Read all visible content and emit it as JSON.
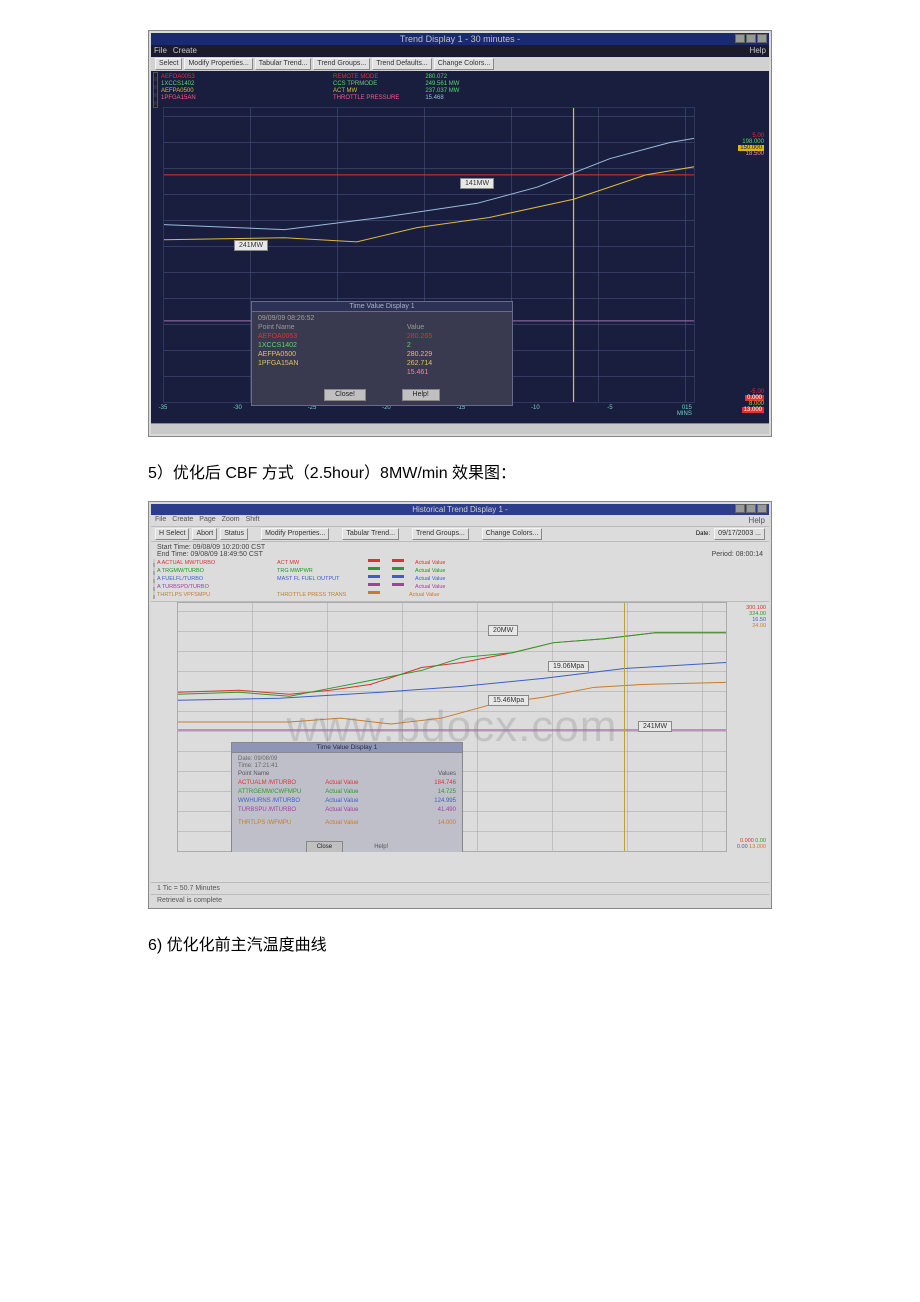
{
  "caption5": "5）优化后 CBF 方式（2.5hour）8MW/min 效果图：",
  "caption6": "6) 优化化前主汽温度曲线",
  "fig1": {
    "title": "Trend Display 1 - 30 minutes -",
    "menubar": [
      "File",
      "Create"
    ],
    "help": "Help",
    "toolbar": {
      "select": "Select",
      "modify": "Modify Properties...",
      "tabular": "Tabular Trend...",
      "groups": "Trend Groups...",
      "defaults": "Trend Defaults...",
      "colors": "Change Colors..."
    },
    "legend": {
      "col1": [
        "AEFOA0053",
        "1XCCS1402",
        "AEFPA0500",
        "1PFGA15AN"
      ],
      "col2": [
        "REMOTE MODE",
        "CCS TPRMODE",
        "ACT    MW",
        "THROTTLE PRESSURE"
      ],
      "col3": [
        "280.072",
        "249.561   MW",
        "237.037   MW",
        "15.468"
      ],
      "colors": {
        "c1": "#d33",
        "c2": "#5bd66b",
        "c3": "#dab93a",
        "c4": "#f58",
        "c5": "#9bd",
        "c6": "#dab93a"
      }
    },
    "axis_right_top": [
      "5.00",
      "198.000",
      "150.000",
      "18.500"
    ],
    "axis_right_bot": [
      "-5.00",
      "0.000",
      "8.000",
      "13.000"
    ],
    "axis_x": [
      "-35",
      "-30",
      "-25",
      "-20",
      "-15",
      "-10",
      "-5",
      "015"
    ],
    "axis_x_label": "MINS",
    "tags": {
      "t1": "241MW",
      "t2": "141MW"
    },
    "popup": {
      "title": "Time Value Display 1",
      "dt": "09/09/09  08:26:52",
      "hdr_name": "Point Name",
      "hdr_val": "Value",
      "rows": [
        {
          "name": "AEFOA0053",
          "val": "280.265",
          "cls": "c-r"
        },
        {
          "name": "1XCCS1402",
          "val": "2",
          "cls": "c-g"
        },
        {
          "name": "AEFPA0500",
          "val": "280.229",
          "cls": "c-y"
        },
        {
          "name": "1PFGA15AN",
          "val": "262.714",
          "cls": "c-y"
        },
        {
          "name": " ",
          "val": "15.461",
          "cls": "c-p"
        }
      ],
      "btn_close": "Close!",
      "btn_help": "Help!"
    }
  },
  "fig2": {
    "title": "Historical Trend Display 1 -",
    "menubar": [
      "File",
      "Create",
      "Page",
      "Zoom",
      "Shift"
    ],
    "help": "Help",
    "toolbar": {
      "select_lbl": "H Select",
      "abort": "Abort",
      "status": "Status",
      "modify": "Modify Properties...",
      "tabular": "Tabular Trend...",
      "groups": "Trend Groups...",
      "colors": "Change Colors...",
      "date_lbl": "Date:",
      "date_val": "09/17/2003 ...",
      "period_lbl": "Period:",
      "period_val": "08:00:14"
    },
    "time": {
      "start": "Start Time:  09/08/09 10:20:00 CST",
      "end": "End Time:    09/08/09 18:49:50 CST"
    },
    "legend_rows": [
      {
        "cls": "c-r",
        "name": "A ACTUAL MW/TURBO",
        "right": "ACT    MW",
        "act": "Actual Value"
      },
      {
        "cls": "c-g",
        "name": "A TRGMW/TURBO",
        "right": "TRG  MWPWR",
        "act": "Actual Value"
      },
      {
        "cls": "c-b",
        "name": "A FUELFL/TURBO",
        "right": "MAST FL FUEL OUTPUT",
        "act": "Actual Value"
      },
      {
        "cls": "c-p",
        "name": "A TURBSPD/TURBO",
        "right": "",
        "act": "Actual Value"
      },
      {
        "cls": "c-o",
        "name": "THRTLPS VPFSMPU",
        "right": "THROTTLE PRESS TRANS",
        "act": "Actual Value"
      }
    ],
    "axis_right_top": [
      "300.100",
      "324.00",
      "16.50",
      "24.00"
    ],
    "axis_right_bot": [
      "0.000",
      "0.00",
      "0.00",
      "13.000"
    ],
    "tags": {
      "t1": "20MW",
      "t2": "19.06Mpa",
      "t3": "15.46Mpa",
      "t4": "241MW"
    },
    "popup": {
      "title": "Time Value Display 1",
      "date": "Date:  09/08/09",
      "time": "Time:  17:21:41",
      "hdr_name": "Point Name",
      "hdr_val": "Values",
      "rows": [
        {
          "name": "ACTUALM /MTURBO",
          "desc": "Actual Value",
          "val": "184.746",
          "cls": "c-r"
        },
        {
          "name": "ATTRGEMW/CWFMPU",
          "desc": "Actual Value",
          "val": "14.725",
          "cls": "c-g"
        },
        {
          "name": "WWHURNS /MTURBO",
          "desc": "Actual Value",
          "val": "124.995",
          "cls": "c-b"
        },
        {
          "name": "TURBSPU /MTURBO",
          "desc": "Actual Value",
          "val": "41.490",
          "cls": "c-p"
        },
        {
          "name": "THRTLPS /WFMPU",
          "desc": "Actual Value",
          "val": "14.000",
          "cls": "c-o"
        }
      ],
      "btn_close": "Close",
      "btn_help": "Help!"
    },
    "bottom": {
      "tick": "1 Tic = 50.7 Minutes",
      "status": "Retrieval is complete"
    },
    "watermark": "www.bdocx.com"
  },
  "chart_data": [
    {
      "type": "line",
      "title": "Trend Display 1 - 30 minutes",
      "xlabel": "MINS",
      "ylabel": "",
      "x": [
        -35,
        -30,
        -25,
        -20,
        -15,
        -10,
        -5,
        0
      ],
      "series": [
        {
          "name": "AEFOA0053 REMOTE MODE",
          "values": [
            280,
            280,
            280,
            280,
            280,
            280,
            280,
            280
          ]
        },
        {
          "name": "1XCCS1402 CCS TPRMODE",
          "values": [
            249,
            249,
            249,
            249,
            249,
            249,
            249,
            249
          ]
        },
        {
          "name": "AEFPA0500 ACT MW",
          "values": [
            200,
            205,
            215,
            230,
            242,
            260,
            275,
            280
          ]
        },
        {
          "name": "1PFGA15AN THROTTLE PRESSURE",
          "values": [
            15.3,
            15.35,
            15.4,
            15.42,
            15.45,
            15.46,
            15.46,
            15.47
          ]
        }
      ],
      "x_range": [
        -35,
        0
      ]
    },
    {
      "type": "line",
      "title": "Historical Trend Display 1",
      "start_time": "09/08/09 10:20:00 CST",
      "end_time": "09/08/09 18:49:50 CST",
      "series": [
        {
          "name": "ACTUAL MW",
          "values": [
            140,
            145,
            150,
            170,
            185,
            195,
            210,
            230,
            241,
            241
          ]
        },
        {
          "name": "TRG MW",
          "values": [
            140,
            145,
            148,
            168,
            182,
            198,
            215,
            232,
            241,
            241
          ]
        },
        {
          "name": "FUEL FLOW",
          "values": [
            100,
            102,
            102,
            110,
            120,
            125,
            130,
            135,
            138,
            138
          ]
        },
        {
          "name": "TURB SPD",
          "values": [
            42,
            42,
            41,
            41,
            41,
            41,
            41,
            41,
            41,
            41
          ]
        },
        {
          "name": "THROTTLE PRESS (Mpa)",
          "values": [
            14,
            14.2,
            14.5,
            15.0,
            15.2,
            15.4,
            15.46,
            18.0,
            19.0,
            19.06
          ]
        }
      ],
      "annotations": [
        "20MW",
        "241MW",
        "15.46Mpa",
        "19.06Mpa"
      ]
    }
  ]
}
